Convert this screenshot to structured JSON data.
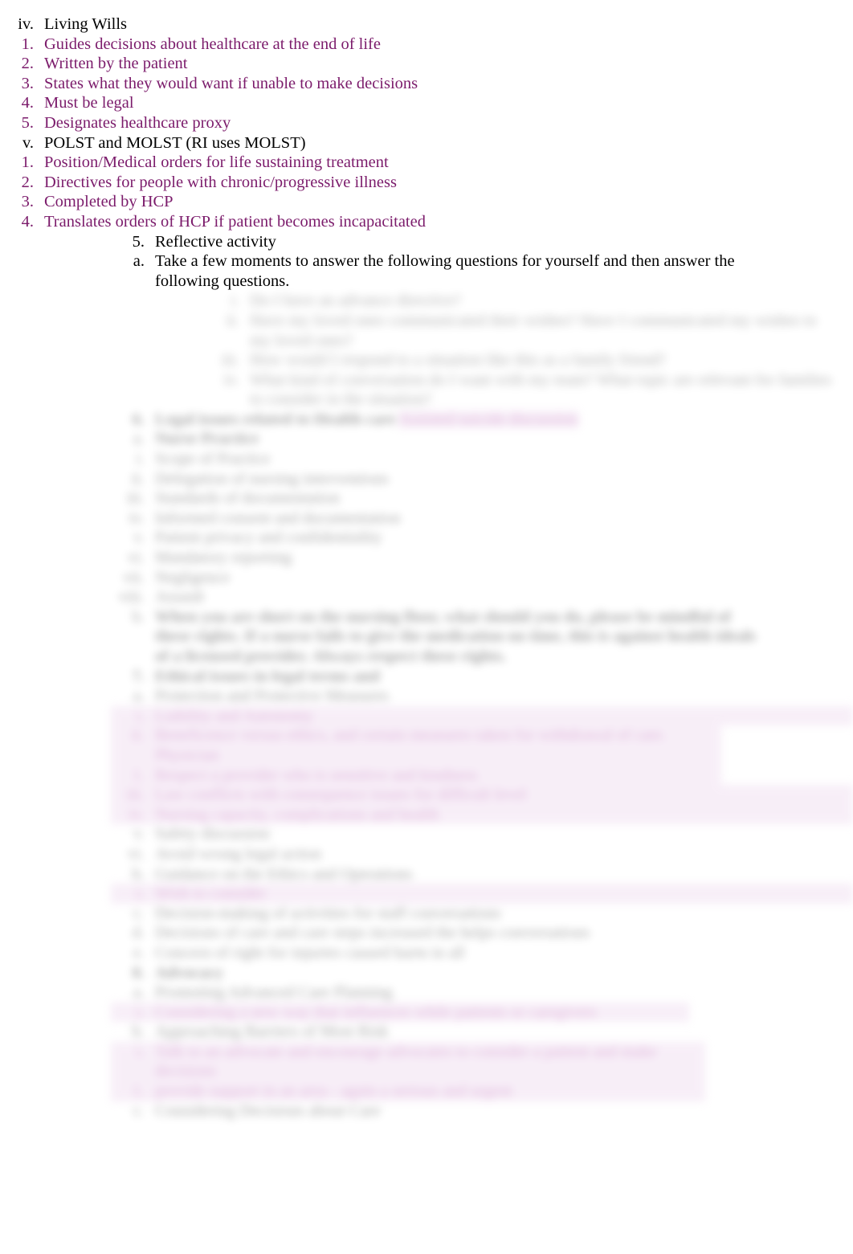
{
  "document": {
    "type": "outline-notes",
    "page_background": "#ffffff",
    "text_color": "#000000",
    "accent_purple": "#7B1B6B",
    "accent_magenta": "#A8339A",
    "highlight_color": "#EBD3EC"
  },
  "sharp_section": {
    "living_wills": {
      "marker": "iv.",
      "label": "Living Wills",
      "children": [
        {
          "marker": "1.",
          "label": "Guides decisions about healthcare at the end of life",
          "color": "purple"
        },
        {
          "marker": "2.",
          "label": "Written by the patient",
          "color": "purple"
        },
        {
          "marker": "3.",
          "label": "States what they would want if unable to make decisions",
          "color": "purple"
        },
        {
          "marker": "4.",
          "label": "Must be legal",
          "color": "purple"
        },
        {
          "marker": "5.",
          "label": "Designates healthcare proxy",
          "color": "purple"
        }
      ]
    },
    "polst_molst": {
      "marker": "v.",
      "label": "POLST and MOLST (RI uses MOLST)",
      "children": [
        {
          "marker": "1.",
          "label": "Position/Medical orders for life sustaining treatment",
          "color": "purple"
        },
        {
          "marker": "2.",
          "label": "Directives for people with chronic/progressive illness",
          "color": "purple"
        },
        {
          "marker": "3.",
          "label": "Completed by HCP",
          "color": "purple"
        },
        {
          "marker": "4.",
          "label": "Translates orders of HCP if patient becomes incapacitated",
          "color": "purple"
        }
      ]
    },
    "reflective_activity": {
      "marker": "5.",
      "label": "Reflective activity",
      "children": [
        {
          "marker": "a.",
          "label": "Take a few moments to answer the following questions for yourself and then answer the following questions.",
          "color": "black"
        }
      ]
    }
  },
  "blurred_section": {
    "note": "Lower portion of the page is visually blurred and illegible in the source image.",
    "reflective_questions": [
      {
        "marker": "i.",
        "label": "Do I have an advance directive?",
        "color": "black"
      },
      {
        "marker": "ii.",
        "label": "Have my loved ones communicated their wishes? Have I communicated my wishes to my loved ones?",
        "color": "black"
      },
      {
        "marker": "iii.",
        "label": "How would I respond to a situation like this as a family friend?",
        "color": "black"
      },
      {
        "marker": "iv.",
        "label": "What kind of conversation do I want with my team? What topic are relevant for families to consider in the situation?",
        "color": "black"
      }
    ],
    "section_6": {
      "marker": "6.",
      "label": "Legal issues related to Health care",
      "trailing_highlight": "Assisted suicide discussion",
      "children": [
        {
          "marker": "a.",
          "label": "Nurse Practice",
          "children": [
            {
              "marker": "i.",
              "label": "Scope of Practice"
            },
            {
              "marker": "ii.",
              "label": "Delegation of nursing interventions"
            },
            {
              "marker": "iii.",
              "label": "Standards of documentation"
            },
            {
              "marker": "iv.",
              "label": "Informed consent and documentation"
            },
            {
              "marker": "v.",
              "label": "Patient privacy and confidentiality"
            },
            {
              "marker": "vi.",
              "label": "Mandatory reporting"
            },
            {
              "marker": "vii.",
              "label": "Negligence"
            },
            {
              "marker": "viii.",
              "label": "Assault"
            }
          ]
        },
        {
          "marker": "b.",
          "label": "When you are short on the nursing floor, what should you do, please be mindful of these rights. If a nurse fails to give the medication on time, this is against health ideals of a licensed provider. Always respect these rights.",
          "bold": true
        }
      ]
    },
    "section_7": {
      "marker": "7.",
      "label": "Ethical issues in legal terms and",
      "children": [
        {
          "marker": "a.",
          "label": "Protection and Protective Measures",
          "children": [
            {
              "marker": "i.",
              "label": "Liability and Autonomy",
              "color": "magenta"
            },
            {
              "marker": "ii.",
              "label": "Beneficence versus ethics, and certain measures taken for withdrawal of care. Physician",
              "color": "magenta",
              "children": [
                {
                  "marker": "1.",
                  "label": "Respect a provider who is sensitive and kindness",
                  "color": "magenta"
                }
              ]
            },
            {
              "marker": "iii.",
              "label": "Law conflicts with consequence issues for difficult level",
              "color": "magenta"
            },
            {
              "marker": "iv.",
              "label": "Nursing capacity, complications and health",
              "color": "magenta"
            },
            {
              "marker": "v.",
              "label": "Safety discussion",
              "color": "black"
            },
            {
              "marker": "vi.",
              "label": "Avoid wrong legal action",
              "color": "black"
            }
          ]
        },
        {
          "marker": "b.",
          "label": "Guidance on the Ethics and Operations",
          "children": [
            {
              "marker": "i.",
              "label": "Wish to consider",
              "color": "magenta"
            }
          ]
        },
        {
          "marker": "c.",
          "label": "Decision-making of activities for staff conversations"
        },
        {
          "marker": "d.",
          "label": "Decisions of care and care steps increased the helps conversations"
        },
        {
          "marker": "e.",
          "label": "Concern of right for injuries caused harm in all"
        }
      ]
    },
    "section_8": {
      "marker": "8.",
      "label": "Advocacy",
      "children": [
        {
          "marker": "a.",
          "label": "Promoting Advanced Care Planning",
          "children": [
            {
              "marker": "i.",
              "label": "Considering a new way that influences while patients or caregivers",
              "color": "magenta"
            }
          ]
        },
        {
          "marker": "b.",
          "label": "Approaching Barriers of Most Risk",
          "children": [
            {
              "marker": "i.",
              "label": "Talk to an advocate and encourage advocates to consider a patient and make decisions",
              "color": "magenta",
              "children": [
                {
                  "marker": "1.",
                  "label": "provide support in an area - again a serious and urgent",
                  "color": "magenta"
                }
              ]
            }
          ]
        },
        {
          "marker": "c.",
          "label": "Considering Decisions about Care"
        }
      ]
    }
  }
}
